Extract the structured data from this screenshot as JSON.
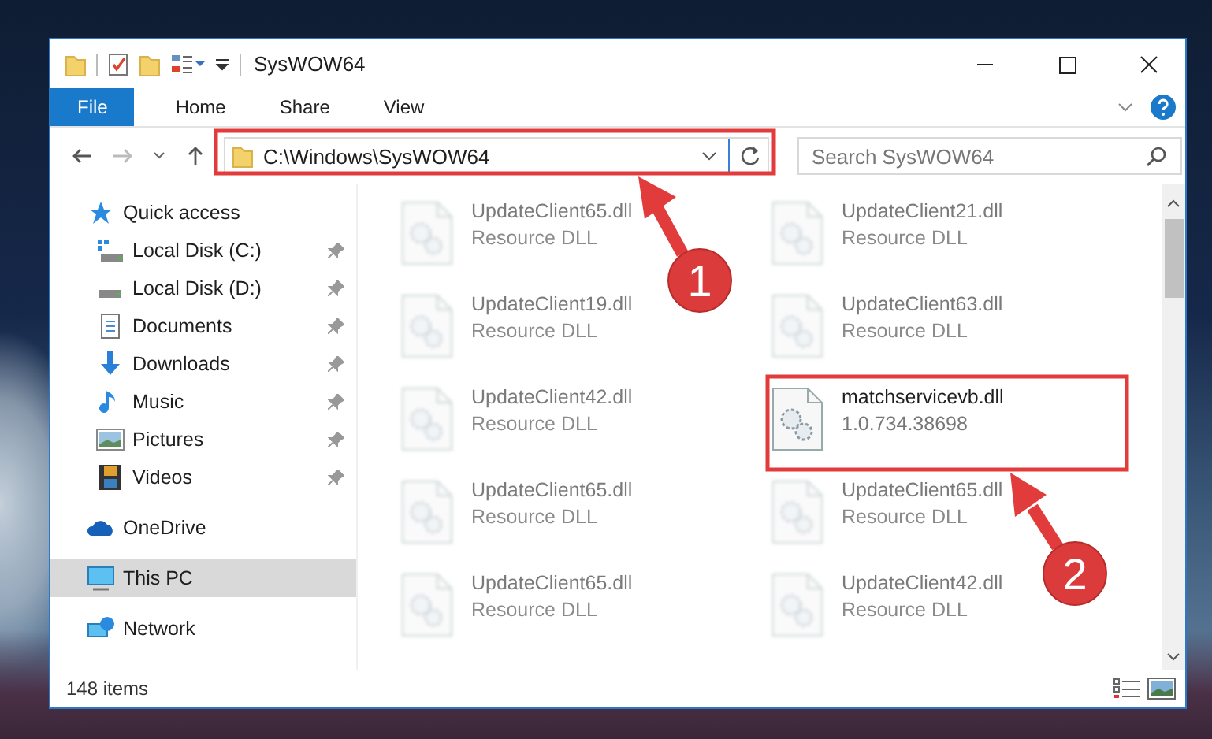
{
  "window": {
    "title": "SysWOW64"
  },
  "ribbon_tabs": [
    {
      "label": "File",
      "kind": "menu"
    },
    {
      "label": "Home",
      "kind": "tab"
    },
    {
      "label": "Share",
      "kind": "tab"
    },
    {
      "label": "View",
      "kind": "tab"
    }
  ],
  "address": {
    "value": "C:\\Windows\\SysWOW64"
  },
  "search": {
    "placeholder": "Search SysWOW64"
  },
  "sidebar": {
    "items": [
      {
        "label": "Quick access",
        "kind": "star",
        "selected": false,
        "children": [
          {
            "label": "Local Disk (C:)",
            "kind": "system-drive",
            "pinned": true,
            "selected": false
          },
          {
            "label": "Local Disk (D:)",
            "kind": "drive",
            "pinned": true,
            "selected": false
          },
          {
            "label": "Documents",
            "kind": "documents",
            "pinned": true,
            "selected": false
          },
          {
            "label": "Downloads",
            "kind": "downloads",
            "pinned": true,
            "selected": false
          },
          {
            "label": "Music",
            "kind": "music",
            "pinned": true,
            "selected": false
          },
          {
            "label": "Pictures",
            "kind": "pictures",
            "pinned": true,
            "selected": false
          },
          {
            "label": "Videos",
            "kind": "videos",
            "pinned": true,
            "selected": false
          }
        ]
      },
      {
        "label": "OneDrive",
        "kind": "cloud",
        "selected": false
      },
      {
        "label": "This PC",
        "kind": "computer",
        "selected": true
      },
      {
        "label": "Network",
        "kind": "network",
        "selected": false
      }
    ]
  },
  "files": [
    {
      "name": "UpdateClient65.dll",
      "detail": "Resource DLL",
      "blurred": true
    },
    {
      "name": "UpdateClient21.dll",
      "detail": "Resource DLL",
      "blurred": true
    },
    {
      "name": "UpdateClient19.dll",
      "detail": "Resource DLL",
      "blurred": true
    },
    {
      "name": "UpdateClient63.dll",
      "detail": "Resource DLL",
      "blurred": true
    },
    {
      "name": "UpdateClient42.dll",
      "detail": "Resource DLL",
      "blurred": true
    },
    {
      "name": "matchservicevb.dll",
      "detail": "1.0.734.38698",
      "blurred": false
    },
    {
      "name": "UpdateClient65.dll",
      "detail": "Resource DLL",
      "blurred": true
    },
    {
      "name": "UpdateClient65.dll",
      "detail": "Resource DLL",
      "blurred": true
    },
    {
      "name": "UpdateClient65.dll",
      "detail": "Resource DLL",
      "blurred": true
    },
    {
      "name": "UpdateClient42.dll",
      "detail": "Resource DLL",
      "blurred": true
    }
  ],
  "status_bar": {
    "item_count": "148 items"
  },
  "annotations": [
    {
      "number": "1"
    },
    {
      "number": "2"
    }
  ]
}
